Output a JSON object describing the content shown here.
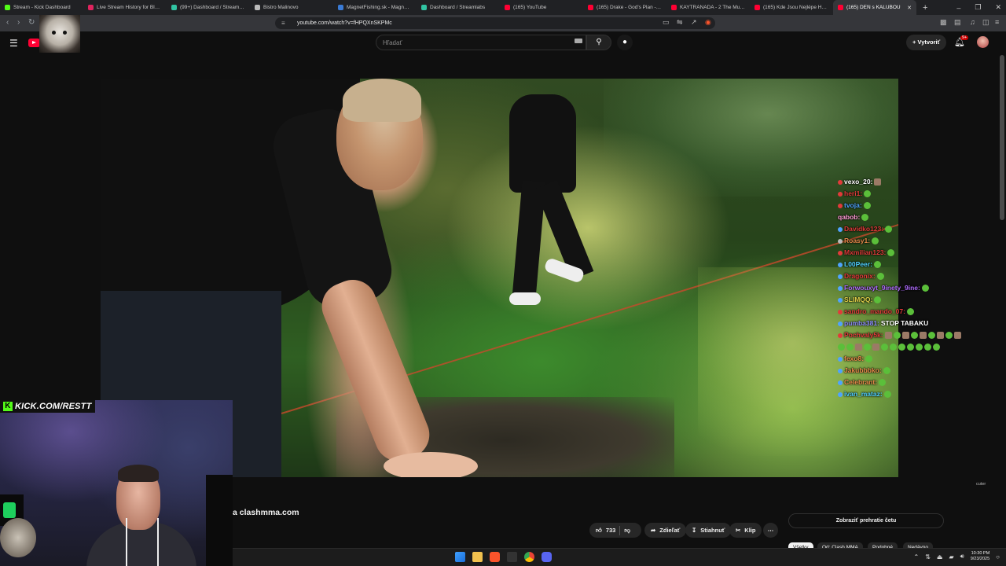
{
  "browser": {
    "tabs": [
      {
        "label": "Stream - Kick Dashboard",
        "color": "#53fc18",
        "active": false
      },
      {
        "label": "Live Stream History for Blerp S",
        "color": "#e0245e",
        "active": false
      },
      {
        "label": "(99+) Dashboard / Streamlabs",
        "color": "#31c3a2",
        "active": false
      },
      {
        "label": "Bistro Malinovo",
        "color": "#bbbbbb",
        "active": false
      },
      {
        "label": "MagnetFishing.sk - Magnety a",
        "color": "#3a7bd5",
        "active": false
      },
      {
        "label": "Dashboard / Streamlabs",
        "color": "#31c3a2",
        "active": false
      },
      {
        "label": "(165) YouTube",
        "color": "#ff0033",
        "active": false
      },
      {
        "label": "(165) Drake - God's Plan - You",
        "color": "#ff0033",
        "active": false
      },
      {
        "label": "KAYTRANADA - 2 The Music U",
        "color": "#ff0033",
        "active": false
      },
      {
        "label": "(165) Kde Jsou Nejlépe Hodno",
        "color": "#ff0033",
        "active": false
      },
      {
        "label": "(165) DEŇ s KALUBOU",
        "color": "#ff0033",
        "active": true
      }
    ],
    "url": "youtube.com/watch?v=fHPQXnSKPMc"
  },
  "youtube": {
    "search_placeholder": "Hľadať",
    "create_label": "Vytvoriť",
    "notifications": "9+",
    "video_title_fragment": "a clashmma.com",
    "likes": "733",
    "share_label": "Zdieľať",
    "download_label": "Stiahnuť",
    "clip_label": "Klip",
    "chat_replay_label": "Zobraziť prehratie četu",
    "watermark": "cuter"
  },
  "overlay": {
    "kick_url": "KICK.COM/RESTT"
  },
  "chat": [
    {
      "user": "vexo_20:",
      "color": "#ffffff",
      "badge": "#e23a3a",
      "message": "",
      "emotes": [
        "brown"
      ]
    },
    {
      "user": "heri1:",
      "color": "#e23a3a",
      "badge": "#e23a3a",
      "message": "",
      "emotes": [
        "green"
      ]
    },
    {
      "user": "tvoja:",
      "color": "#4fa3ff",
      "badge": "#e23a3a",
      "message": "",
      "emotes": [
        "green"
      ]
    },
    {
      "user": "qabob:",
      "color": "#ff9ad5",
      "badge": "",
      "message": "",
      "emotes": [
        "green"
      ]
    },
    {
      "user": "Davidko123:",
      "color": "#e23a3a",
      "badge": "#4fa3ff",
      "message": "",
      "emotes": [
        "green"
      ]
    },
    {
      "user": "Roasy1:",
      "color": "#e88a4a",
      "badge": "#bbbbbb",
      "message": "",
      "emotes": [
        "green"
      ]
    },
    {
      "user": "Mxmilian123:",
      "color": "#e23a3a",
      "badge": "#e23a3a",
      "message": "",
      "emotes": [
        "green"
      ]
    },
    {
      "user": "L00Peer:",
      "color": "#4fd0ff",
      "badge": "#4fa3ff",
      "message": "",
      "emotes": [
        "green"
      ]
    },
    {
      "user": "Dragonix:",
      "color": "#e23a3a",
      "badge": "#4fa3ff",
      "message": "",
      "emotes": [
        "green"
      ]
    },
    {
      "user": "Forwouxyt_9inety_9ine:",
      "color": "#b06bff",
      "badge": "#4fa3ff",
      "message": "",
      "emotes": [
        "green"
      ]
    },
    {
      "user": "SLIMQQ:",
      "color": "#e0d24a",
      "badge": "#4fa3ff",
      "message": "",
      "emotes": [
        "green"
      ]
    },
    {
      "user": "sandro_mando_07:",
      "color": "#e23a3a",
      "badge": "#e23a3a",
      "message": "",
      "emotes": [
        "green"
      ]
    },
    {
      "user": "pumba381:",
      "color": "#8f8fff",
      "badge": "#4fa3ff",
      "message": "STOP TABAKU",
      "emotes": []
    },
    {
      "user": "Pochvaly5k:",
      "color": "#e23a3a",
      "badge": "#e23a3a",
      "message": "",
      "emotes": [
        "brown",
        "green",
        "brown",
        "green",
        "brown",
        "green",
        "brown",
        "green",
        "brown"
      ]
    },
    {
      "user": "",
      "color": "#ffffff",
      "badge": "",
      "message": "",
      "emotes": [
        "green",
        "green",
        "brown",
        "green",
        "brown",
        "green",
        "green",
        "green",
        "green",
        "green",
        "green",
        "green"
      ]
    },
    {
      "user": "fexo8:",
      "color": "#e88a4a",
      "badge": "#4fa3ff",
      "message": "",
      "emotes": [
        "green"
      ]
    },
    {
      "user": "Jakubbbko:",
      "color": "#e88a4a",
      "badge": "#4fa3ff",
      "message": "",
      "emotes": [
        "green"
      ]
    },
    {
      "user": "Celebrant:",
      "color": "#e88a4a",
      "badge": "#4fa3ff",
      "message": "",
      "emotes": [
        "green"
      ]
    },
    {
      "user": "ivan_mataz:",
      "color": "#4fd0ff",
      "badge": "#4fa3ff",
      "message": "",
      "emotes": [
        "green"
      ]
    }
  ],
  "chips": [
    {
      "label": "Všetky",
      "active": true
    },
    {
      "label": "Od: Clash MMA",
      "active": false
    },
    {
      "label": "Podobné",
      "active": false
    },
    {
      "label": "Nedávno",
      "active": false
    }
  ],
  "taskbar": {
    "time": "10:30 PM",
    "date": "9/23/2025"
  }
}
